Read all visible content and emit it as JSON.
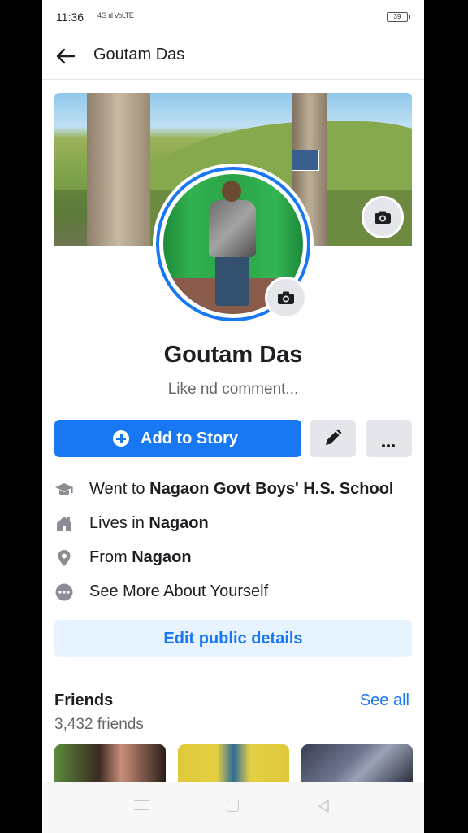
{
  "status_bar": {
    "time": "11:36",
    "signal": "4G ııl VoLTE",
    "battery": "39"
  },
  "header": {
    "title": "Goutam Das",
    "back_icon": "arrow-left-icon"
  },
  "profile": {
    "name": "Goutam Das",
    "bio": "Like nd comment...",
    "cover_camera_icon": "camera-icon",
    "avatar_camera_icon": "camera-icon"
  },
  "actions": {
    "add_to_story": "Add to Story",
    "edit_icon": "pencil-icon",
    "more_icon": "more-dots-icon"
  },
  "details": [
    {
      "icon": "graduation-cap-icon",
      "prefix": "Went to ",
      "value": "Nagaon Govt Boys' H.S. School"
    },
    {
      "icon": "home-icon",
      "prefix": "Lives in ",
      "value": "Nagaon"
    },
    {
      "icon": "location-pin-icon",
      "prefix": "From ",
      "value": "Nagaon"
    },
    {
      "icon": "more-circle-icon",
      "prefix": "See More About Yourself",
      "value": ""
    }
  ],
  "edit_public_details": "Edit public details",
  "friends": {
    "title": "Friends",
    "see_all": "See all",
    "count": "3,432 friends"
  },
  "colors": {
    "accent": "#1877f2",
    "accent_light": "#e7f3ff",
    "secondary_text": "#65676b",
    "button_gray": "#e4e6eb"
  }
}
